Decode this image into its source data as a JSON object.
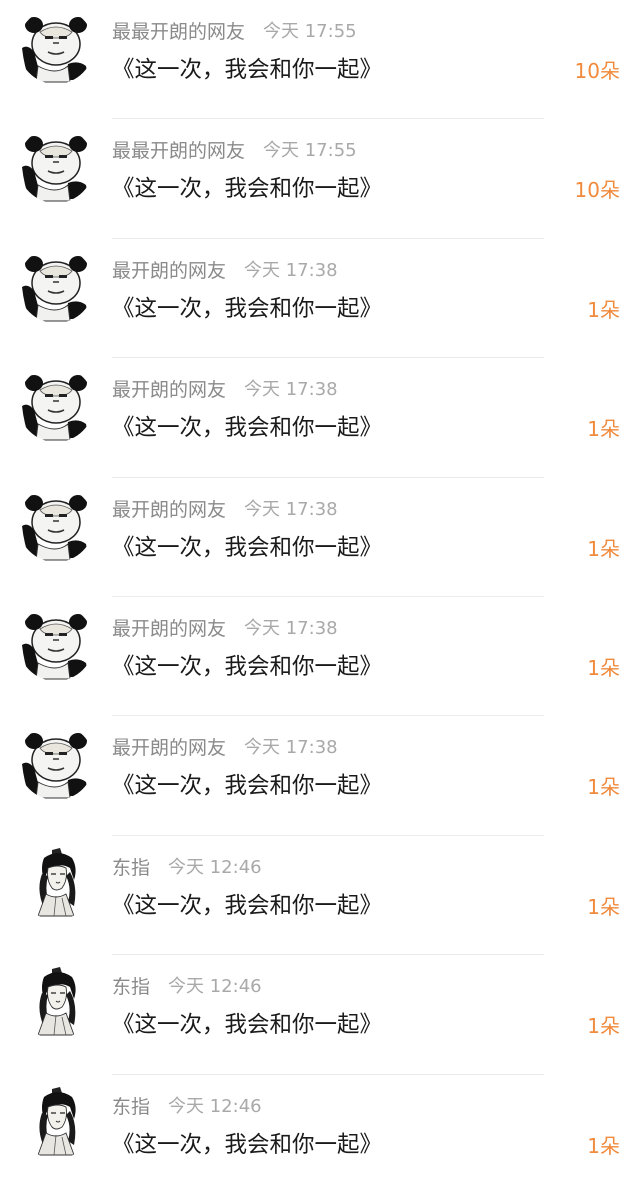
{
  "gifts": [
    {
      "avatar": "panda-meme",
      "name": "最最开朗的网友",
      "time": "今天 17:55",
      "message": "《这一次，我会和你一起》",
      "count": "10朵"
    },
    {
      "avatar": "panda-meme",
      "name": "最最开朗的网友",
      "time": "今天 17:55",
      "message": "《这一次，我会和你一起》",
      "count": "10朵"
    },
    {
      "avatar": "panda-meme",
      "name": "最开朗的网友",
      "time": "今天 17:38",
      "message": "《这一次，我会和你一起》",
      "count": "1朵"
    },
    {
      "avatar": "panda-meme",
      "name": "最开朗的网友",
      "time": "今天 17:38",
      "message": "《这一次，我会和你一起》",
      "count": "1朵"
    },
    {
      "avatar": "panda-meme",
      "name": "最开朗的网友",
      "time": "今天 17:38",
      "message": "《这一次，我会和你一起》",
      "count": "1朵"
    },
    {
      "avatar": "panda-meme",
      "name": "最开朗的网友",
      "time": "今天 17:38",
      "message": "《这一次，我会和你一起》",
      "count": "1朵"
    },
    {
      "avatar": "panda-meme",
      "name": "最开朗的网友",
      "time": "今天 17:38",
      "message": "《这一次，我会和你一起》",
      "count": "1朵"
    },
    {
      "avatar": "ink-portrait",
      "name": "东指",
      "time": "今天 12:46",
      "message": "《这一次，我会和你一起》",
      "count": "1朵"
    },
    {
      "avatar": "ink-portrait",
      "name": "东指",
      "time": "今天 12:46",
      "message": "《这一次，我会和你一起》",
      "count": "1朵"
    },
    {
      "avatar": "ink-portrait",
      "name": "东指",
      "time": "今天 12:46",
      "message": "《这一次，我会和你一起》",
      "count": "1朵"
    }
  ],
  "colors": {
    "count": "#f08a3c",
    "name": "#8a8a8a",
    "time": "#a9a9a9",
    "message": "#1a1a1a"
  }
}
